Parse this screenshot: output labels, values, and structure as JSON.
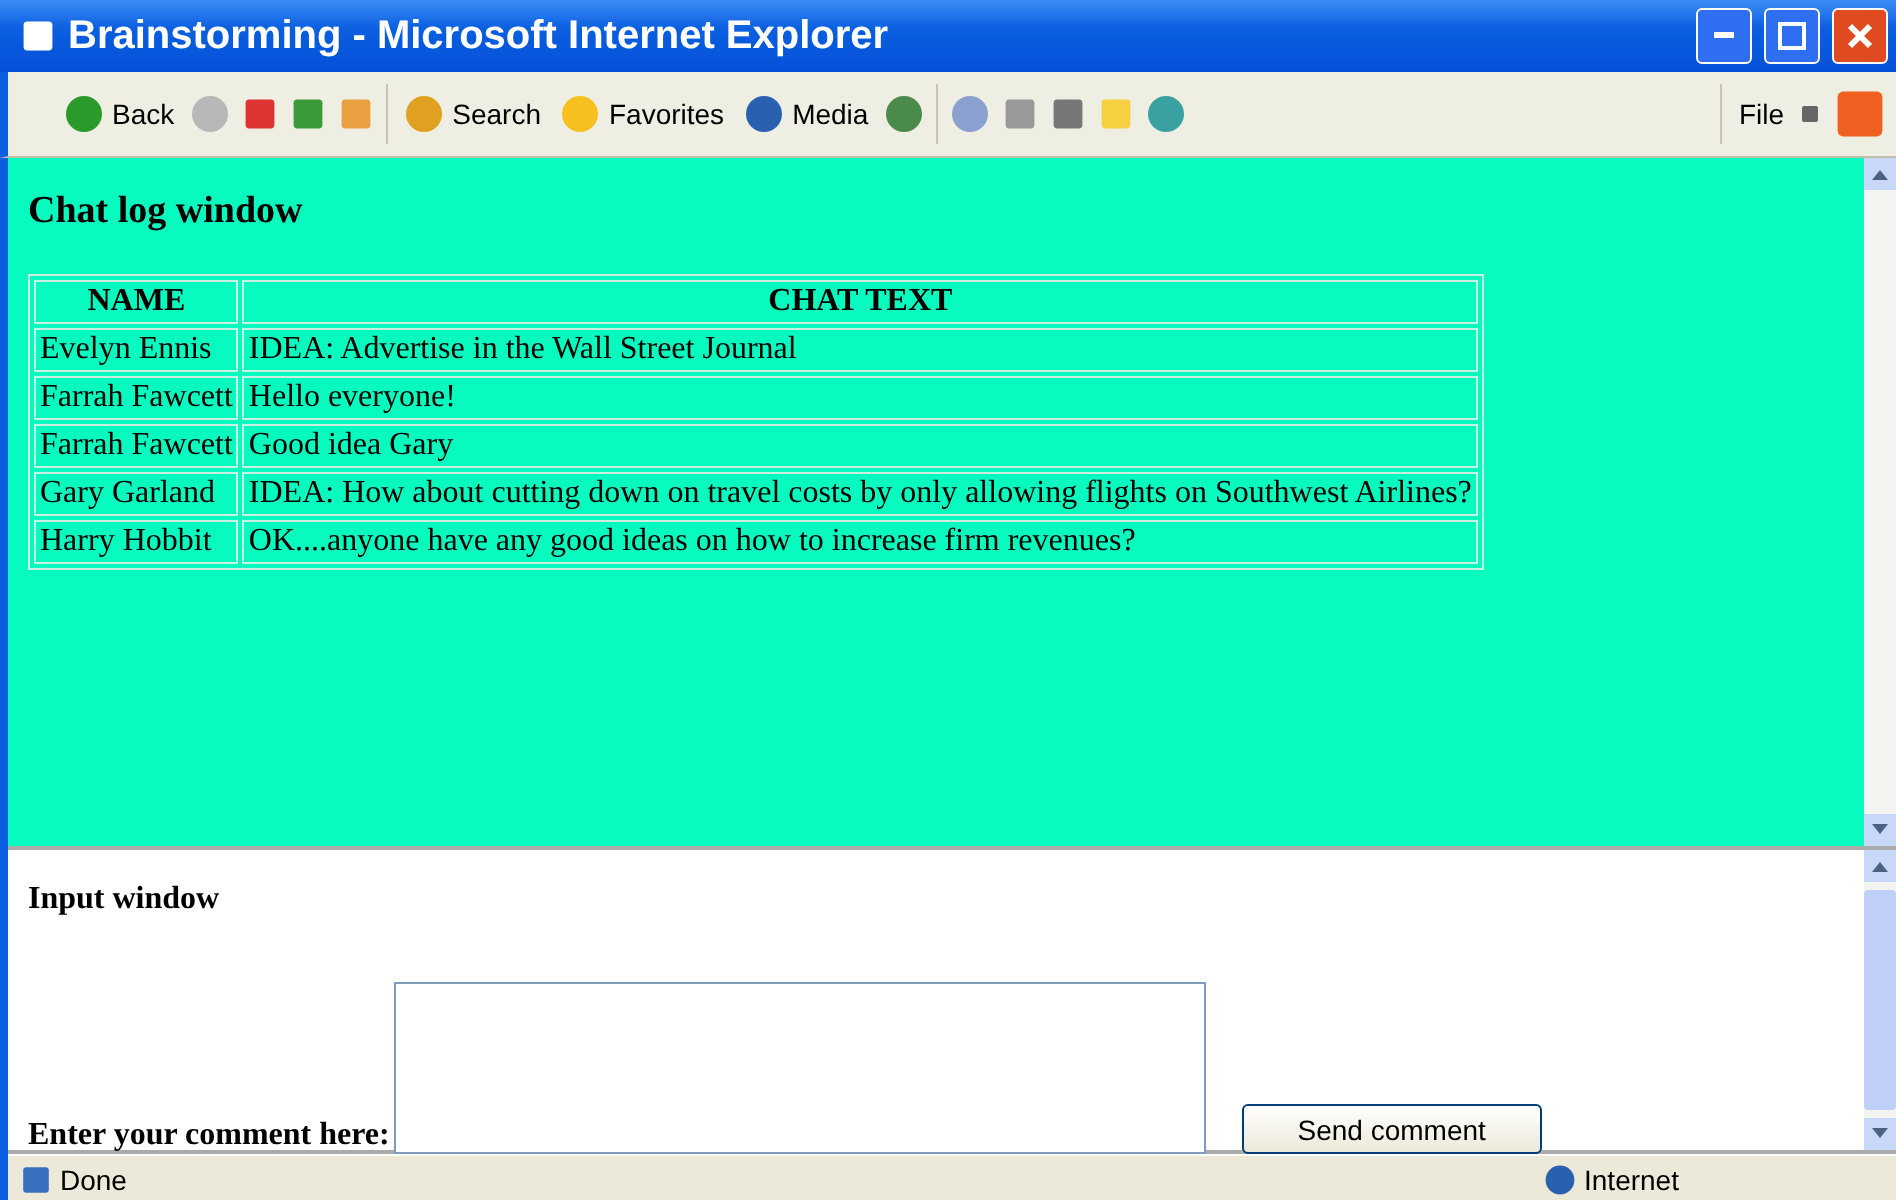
{
  "window": {
    "title": "Brainstorming - Microsoft Internet Explorer"
  },
  "toolbar": {
    "back": "Back",
    "search": "Search",
    "favorites": "Favorites",
    "media": "Media",
    "menu": "File"
  },
  "chat_frame": {
    "heading": "Chat log window",
    "columns": [
      "NAME",
      "CHAT TEXT"
    ],
    "rows": [
      {
        "name": "Evelyn Ennis",
        "text": "IDEA: Advertise in the Wall Street Journal"
      },
      {
        "name": "Farrah Fawcett",
        "text": "Hello everyone!"
      },
      {
        "name": "Farrah Fawcett",
        "text": "Good idea Gary"
      },
      {
        "name": "Gary Garland",
        "text": "IDEA: How about cutting down on travel costs by only allowing flights on Southwest Airlines?"
      },
      {
        "name": "Harry Hobbit",
        "text": "OK....anyone have any good ideas on how to increase firm revenues?"
      }
    ]
  },
  "input_frame": {
    "heading": "Input window",
    "label": "Enter your comment here:",
    "button": "Send comment"
  },
  "status_bar": {
    "status": "Done",
    "zone": "Internet"
  }
}
